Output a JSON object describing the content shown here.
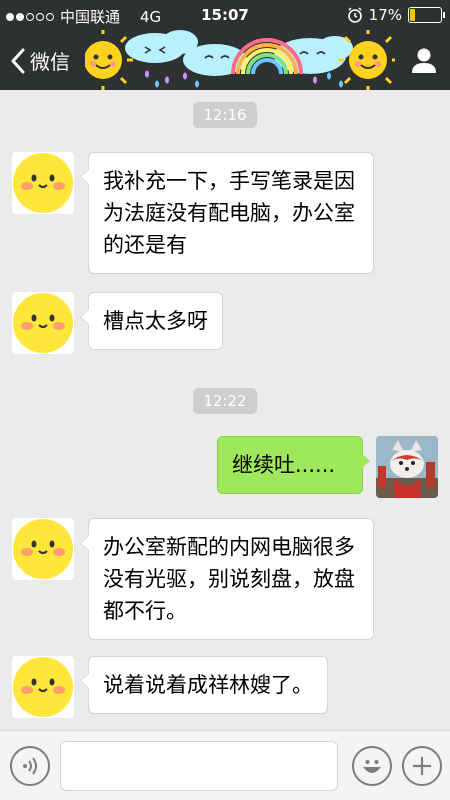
{
  "status_bar": {
    "carrier": "中国联通",
    "network": "4G",
    "time": "15:07",
    "battery_percent": "17%",
    "battery_level": 0.17,
    "signal_dots": [
      true,
      true,
      false,
      false,
      false
    ]
  },
  "nav": {
    "back_label": "微信"
  },
  "messages": [
    {
      "type": "timestamp",
      "text": "12:16"
    },
    {
      "type": "incoming",
      "text": "我补充一下，手写笔录是因为法庭没有配电脑，办公室的还是有"
    },
    {
      "type": "incoming",
      "text": "槽点太多呀"
    },
    {
      "type": "timestamp",
      "text": "12:22"
    },
    {
      "type": "outgoing",
      "text": "继续吐......"
    },
    {
      "type": "incoming",
      "text": "办公室新配的内网电脑很多没有光驱，别说刻盘，放盘都不行。"
    },
    {
      "type": "incoming",
      "text": "说着说着成祥林嫂了。"
    }
  ],
  "colors": {
    "bar_dark": "#2e3132",
    "chat_bg": "#ebebeb",
    "outgoing_bubble": "#9fe75b",
    "incoming_bubble": "#ffffff",
    "emoji_yellow": "#ffe63b"
  },
  "icons": {
    "back": "chevron-left-icon",
    "profile": "person-icon",
    "voice": "voice-icon",
    "emoji": "smiley-icon",
    "more": "plus-icon"
  }
}
